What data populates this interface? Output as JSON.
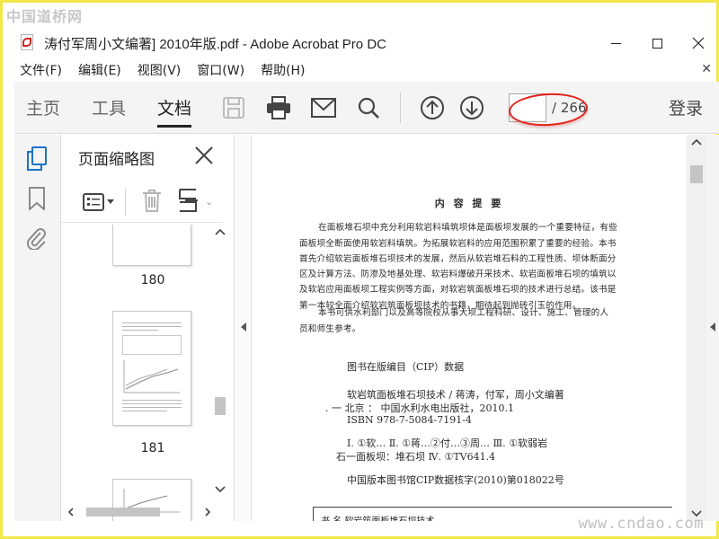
{
  "watermark_top": "中国道桥网",
  "watermark_bottom": "www.cndao.com",
  "window": {
    "title": "涛付军周小文编著] 2010年版.pdf - Adobe Acrobat Pro DC"
  },
  "menu": {
    "items": [
      {
        "label": "文件(F)"
      },
      {
        "label": "编辑(E)"
      },
      {
        "label": "视图(V)"
      },
      {
        "label": "窗口(W)"
      },
      {
        "label": "帮助(H)"
      }
    ]
  },
  "toolbar": {
    "tabs": [
      {
        "label": "主页"
      },
      {
        "label": "工具"
      },
      {
        "label": "文档"
      }
    ],
    "active_tab": "文档",
    "page_current": "",
    "page_total": "/ 266",
    "login_label": "登录"
  },
  "thumbnails_panel": {
    "title": "页面缩略图",
    "pages": [
      {
        "number": "180"
      },
      {
        "number": "181"
      }
    ]
  },
  "document": {
    "heading": "内 容 提 要",
    "summary_lines": [
      "在面板堆石坝中充分利用软岩料填筑坝体是面板坝发展的一个重要特征，有些",
      "面板坝全断面使用软岩料填筑。为拓展软岩料的应用范围积累了重要的经验。本书",
      "首先介绍软岩面板堆石坝技术的发展，然后从软岩堆石料的工程性质、坝体断面分",
      "区及计算方法、防渗及地基处理、软岩料爆破开采技术、软岩面板堆石坝的填筑以",
      "及软岩应用面板坝工程实例等方面，对软岩筑面板堆石坝的技术进行总结。该书是",
      "第一本较全面介绍软岩筑面板坝技术的书籍，期待起到抛砖引玉的作用。",
      "本书可供水利部门以及高等院校从事大坝工程科研、设计、施工、管理的人",
      "员和师生参考。"
    ],
    "cip_title": "图书在版编目（CIP）数据",
    "cip_lines": [
      "软岩筑面板堆石坝技术 / 蒋涛，付军，周小文编著",
      ". 一 北京 ： 中国水利水电出版社，2010.1",
      "ISBN 978-7-5084-7191-4",
      "Ⅰ. ①软…  Ⅱ. ①蒋…②付…③周…  Ⅲ. ①软弱岩",
      "石一面板坝：堆石坝  Ⅳ. ①TV641.4",
      "中国版本图书馆CIP数据核字(2010)第018022号"
    ],
    "bottom_cut": "书    名    软岩筑面板堆石坝技术"
  },
  "colors": {
    "highlight_ring": "#e2231a",
    "watermark_border": "#f2e84a"
  }
}
